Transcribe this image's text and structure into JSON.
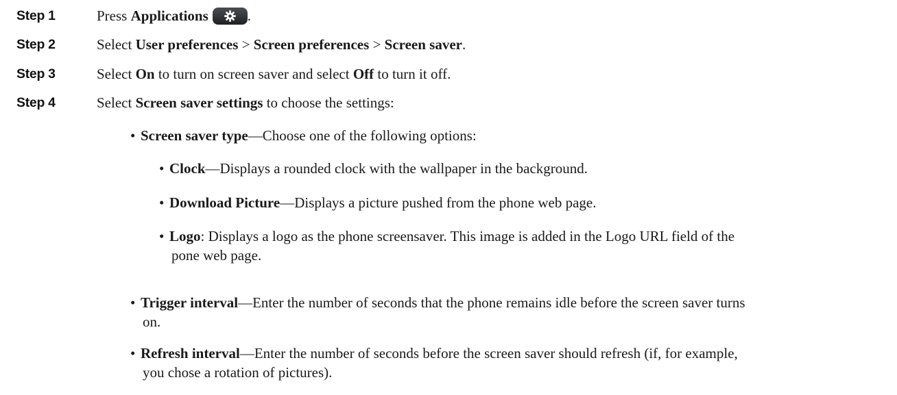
{
  "steps": [
    {
      "label": "Step 1",
      "text": {
        "pre": "Press ",
        "b1": "Applications",
        "post": "."
      },
      "icon": "gear-icon"
    },
    {
      "label": "Step 2",
      "text": {
        "pre": "Select ",
        "b1": "User preferences",
        "sep1": " > ",
        "b2": "Screen preferences",
        "sep2": " > ",
        "b3": "Screen saver",
        "post": "."
      }
    },
    {
      "label": "Step 3",
      "text": {
        "pre": "Select ",
        "b1": "On",
        "mid": " to turn on screen saver and select ",
        "b2": "Off",
        "post": " to turn it off."
      }
    },
    {
      "label": "Step 4",
      "text": {
        "pre": "Select ",
        "b1": "Screen saver settings",
        "post": " to choose the settings:"
      }
    }
  ],
  "settings": {
    "type": {
      "bullet": "•",
      "term": "Screen saver type",
      "desc": "—Choose one of the following options:",
      "options": [
        {
          "bullet": "•",
          "term": "Clock",
          "desc": "—Displays a rounded clock with the wallpaper in the background."
        },
        {
          "bullet": "•",
          "term": "Download Picture",
          "desc": "—Displays a picture pushed from the phone web page."
        },
        {
          "bullet": "•",
          "term": "Logo",
          "desc": ": Displays a logo as the phone screensaver. This image is added in the Logo URL field of the",
          "desc_cont": "pone web page."
        }
      ]
    },
    "trigger": {
      "bullet": "•",
      "term": "Trigger interval",
      "desc": "—Enter the number of seconds that the phone remains idle before the screen saver turns",
      "desc_cont": "on."
    },
    "refresh": {
      "bullet": "•",
      "term": "Refresh interval",
      "desc": "—Enter the number of seconds before the screen saver should refresh (if, for example,",
      "desc_cont": "you chose a rotation of pictures)."
    }
  }
}
